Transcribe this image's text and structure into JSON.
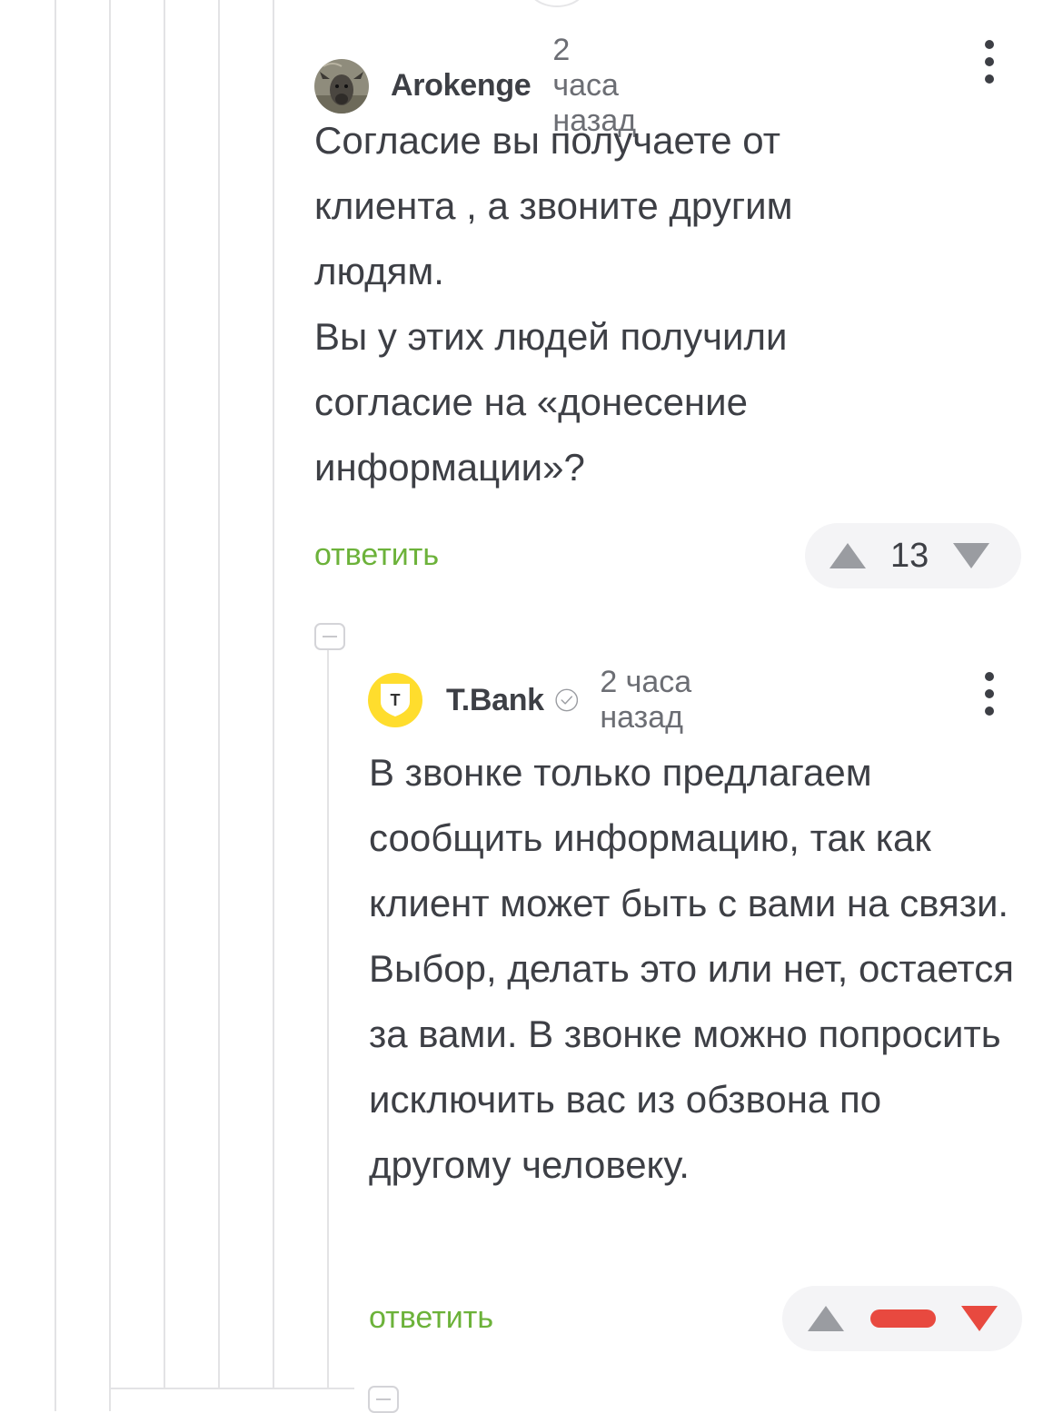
{
  "comment1": {
    "author": "Arokenge",
    "time": "2 часа назад",
    "avatar_icon": "goat-avatar",
    "paragraphs": [
      "Согласие вы получаете от клиента , а звоните другим людям.",
      "Вы у этих людей получили согласие на «донесение информации»?"
    ],
    "reply_label": "ответить",
    "rating": "13"
  },
  "comment2": {
    "author": "T.Bank",
    "time": "2 часа назад",
    "avatar_icon": "tbank-logo",
    "avatar_letter": "Т",
    "paragraphs": [
      "В звонке только предлагаем сообщить информацию, так как клиент может быть с вами на связи. Выбор, делать это или нет, остается за вами. В звонке можно попросить исключить вас из обзвона по другому человеку."
    ],
    "reply_label": "ответить",
    "rating_state": "negative"
  },
  "colors": {
    "text": "#3d3f45",
    "muted": "#6c6e74",
    "reply_green": "#6cb23a",
    "negative_red": "#e8493f",
    "arrow_gray": "#9a9ca1",
    "pill_bg": "#f4f4f6",
    "tbank_yellow": "#ffdd2d"
  }
}
